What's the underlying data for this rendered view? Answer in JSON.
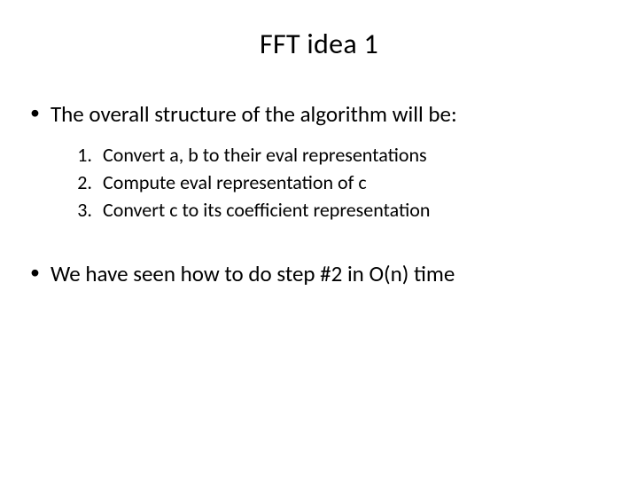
{
  "title": "FFT idea 1",
  "bullet1": "The overall structure of the algorithm will be:",
  "steps": {
    "n1": "1.",
    "t1": "Convert a, b to their eval representations",
    "n2": "2.",
    "t2": "Compute eval representation of c",
    "n3": "3.",
    "t3": "Convert c to its coefficient representation"
  },
  "bullet2": "We have seen how to do step #2 in O(n) time",
  "bullet_char": "•"
}
